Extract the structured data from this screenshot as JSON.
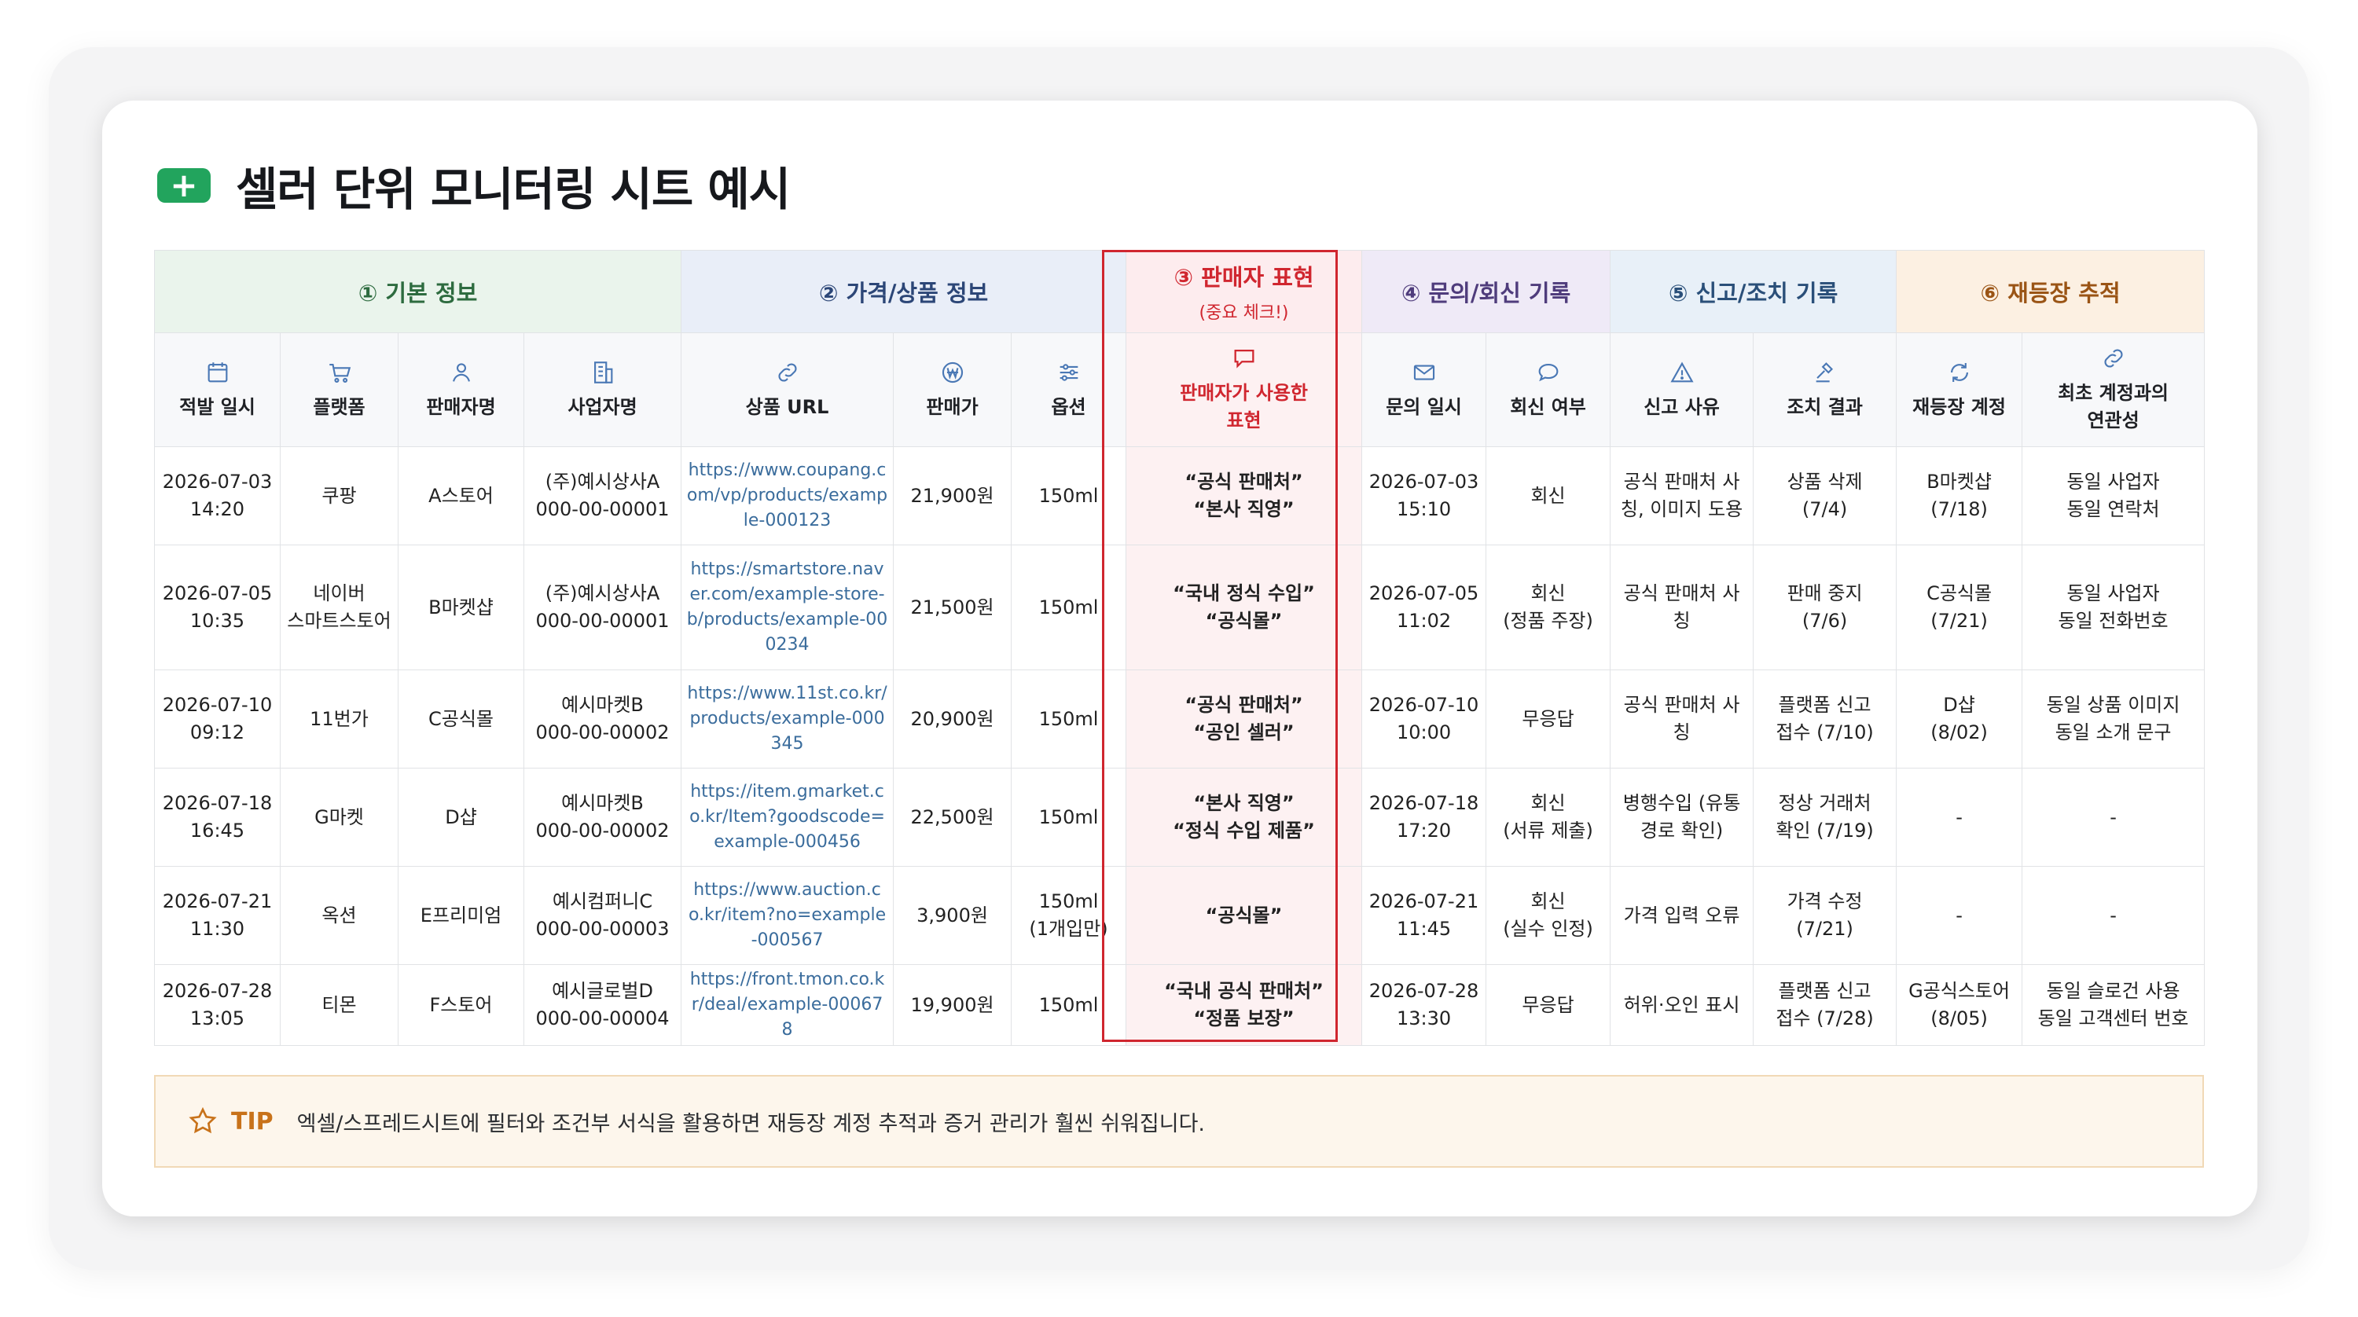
{
  "title": "셀러 단위 모니터링 시트 예시",
  "groups": {
    "basic": "① 기본 정보",
    "price": "② 가격/상품 정보",
    "seller": "③ 판매자 표현",
    "seller_sub": "(중요 체크!)",
    "inquiry": "④ 문의/회신 기록",
    "report": "⑤ 신고/조치 기록",
    "reregister": "⑥ 재등장 추적"
  },
  "columns": {
    "date": "적발 일시",
    "platform": "플랫폼",
    "seller": "판매자명",
    "business": "사업자명",
    "url": "상품 URL",
    "price": "판매가",
    "option": "옵션",
    "expression_1": "판매자가 사용한",
    "expression_2": "표현",
    "inq_date": "문의 일시",
    "reply": "회신 여부",
    "reason": "신고 사유",
    "action": "조치 결과",
    "re_account": "재등장 계정",
    "relation_1": "최초 계정과의",
    "relation_2": "연관성"
  },
  "icons": {
    "date": "calendar-icon",
    "platform": "cart-icon",
    "seller": "user-icon",
    "business": "building-icon",
    "url": "link-icon",
    "price": "won-coin-icon",
    "option": "sliders-icon",
    "expression": "speech-bubble-icon",
    "inq_date": "mail-icon",
    "reply": "chat-bubble-icon",
    "reason": "warning-icon",
    "action": "gavel-icon",
    "re_account": "refresh-icon",
    "relation": "link-icon"
  },
  "rows": [
    {
      "date_1": "2026-07-03",
      "date_2": "14:20",
      "platform": "쿠팡",
      "platform_2": "",
      "seller": "A스토어",
      "business_1": "(주)예시상사A",
      "business_2": "000-00-00001",
      "url": "https://www.coupang.com/vp/products/example-000123",
      "price": "21,900원",
      "option_1": "150ml",
      "option_2": "",
      "expr_1": "“공식 판매처”",
      "expr_2": "“본사 직영”",
      "inq_1": "2026-07-03",
      "inq_2": "15:10",
      "reply_1": "회신",
      "reply_2": "",
      "reason": "공식 판매처 사칭, 이미지 도용",
      "action_1": "상품 삭제",
      "action_2": "(7/4)",
      "re_1": "B마켓샵",
      "re_2": "(7/18)",
      "rel_1": "동일 사업자",
      "rel_2": "동일 연락처"
    },
    {
      "date_1": "2026-07-05",
      "date_2": "10:35",
      "platform": "네이버",
      "platform_2": "스마트스토어",
      "seller": "B마켓샵",
      "business_1": "(주)예시상사A",
      "business_2": "000-00-00001",
      "url": "https://smartstore.naver.com/example-store-b/products/example-000234",
      "price": "21,500원",
      "option_1": "150ml",
      "option_2": "",
      "expr_1": "“국내 정식 수입”",
      "expr_2": "“공식몰”",
      "inq_1": "2026-07-05",
      "inq_2": "11:02",
      "reply_1": "회신",
      "reply_2": "(정품 주장)",
      "reason": "공식 판매처 사칭",
      "action_1": "판매 중지",
      "action_2": "(7/6)",
      "re_1": "C공식몰",
      "re_2": "(7/21)",
      "rel_1": "동일 사업자",
      "rel_2": "동일 전화번호"
    },
    {
      "date_1": "2026-07-10",
      "date_2": "09:12",
      "platform": "11번가",
      "platform_2": "",
      "seller": "C공식몰",
      "business_1": "예시마켓B",
      "business_2": "000-00-00002",
      "url": "https://www.11st.co.kr/products/example-000345",
      "price": "20,900원",
      "option_1": "150ml",
      "option_2": "",
      "expr_1": "“공식 판매처”",
      "expr_2": "“공인 셀러”",
      "inq_1": "2026-07-10",
      "inq_2": "10:00",
      "reply_1": "무응답",
      "reply_2": "",
      "reason": "공식 판매처 사칭",
      "action_1": "플랫폼 신고",
      "action_2": "접수 (7/10)",
      "re_1": "D샵",
      "re_2": "(8/02)",
      "rel_1": "동일 상품 이미지",
      "rel_2": "동일 소개 문구"
    },
    {
      "date_1": "2026-07-18",
      "date_2": "16:45",
      "platform": "G마켓",
      "platform_2": "",
      "seller": "D샵",
      "business_1": "예시마켓B",
      "business_2": "000-00-00002",
      "url": "https://item.gmarket.co.kr/Item?goodscode=example-000456",
      "price": "22,500원",
      "option_1": "150ml",
      "option_2": "",
      "expr_1": "“본사 직영”",
      "expr_2": "“정식 수입 제품”",
      "inq_1": "2026-07-18",
      "inq_2": "17:20",
      "reply_1": "회신",
      "reply_2": "(서류 제출)",
      "reason": "병행수입 (유통경로 확인)",
      "action_1": "정상 거래처",
      "action_2": "확인 (7/19)",
      "re_1": "-",
      "re_2": "",
      "rel_1": "-",
      "rel_2": ""
    },
    {
      "date_1": "2026-07-21",
      "date_2": "11:30",
      "platform": "옥션",
      "platform_2": "",
      "seller": "E프리미엄",
      "business_1": "예시컴퍼니C",
      "business_2": "000-00-00003",
      "url": "https://www.auction.co.kr/item?no=example-000567",
      "price": "3,900원",
      "option_1": "150ml",
      "option_2": "(1개입만)",
      "expr_1": "“공식몰”",
      "expr_2": "",
      "inq_1": "2026-07-21",
      "inq_2": "11:45",
      "reply_1": "회신",
      "reply_2": "(실수 인정)",
      "reason": "가격 입력 오류",
      "action_1": "가격 수정",
      "action_2": "(7/21)",
      "re_1": "-",
      "re_2": "",
      "rel_1": "-",
      "rel_2": ""
    },
    {
      "date_1": "2026-07-28",
      "date_2": "13:05",
      "platform": "티몬",
      "platform_2": "",
      "seller": "F스토어",
      "business_1": "예시글로벌D",
      "business_2": "000-00-00004",
      "url": "https://front.tmon.co.kr/deal/example-000678",
      "price": "19,900원",
      "option_1": "150ml",
      "option_2": "",
      "expr_1": "“국내 공식 판매처”",
      "expr_2": "“정품 보장”",
      "inq_1": "2026-07-28",
      "inq_2": "13:30",
      "reply_1": "무응답",
      "reply_2": "",
      "reason": "허위·오인 표시",
      "action_1": "플랫폼 신고",
      "action_2": "접수 (7/28)",
      "re_1": "G공식스토어",
      "re_2": "(8/05)",
      "rel_1": "동일 슬로건 사용",
      "rel_2": "동일 고객센터 번호"
    }
  ],
  "tip": {
    "label": "TIP",
    "text": "엑셀/스프레드시트에 필터와 조건부 서식을 활용하면 재등장 계정 추적과 증거 관리가 훨씬 쉬워집니다."
  },
  "colors": {
    "accent_green": "#22a45d",
    "seller_red": "#d0262f",
    "tip_orange": "#c8721a"
  }
}
